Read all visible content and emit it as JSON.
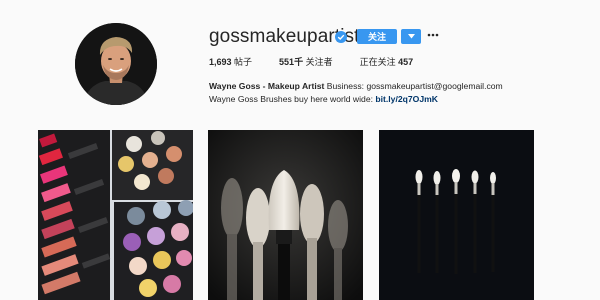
{
  "profile": {
    "username": "gossmakeupartist",
    "follow_label": "关注",
    "full_name": "Wayne Goss - Makeup Artist",
    "bio_text": " Business: gossmakeupartist@googlemail.com Wayne Goss Brushes buy here world wide: ",
    "bio_link": "bit.ly/2q7OJmK"
  },
  "stats": {
    "posts_count": "1,693",
    "posts_label": " 帖子",
    "followers_count": "551千",
    "followers_label": " 关注者",
    "following_label": "正在关注 ",
    "following_count": "457"
  },
  "icons": {
    "verified": "verified-badge-icon",
    "dropdown": "chevron-down-icon",
    "more": "more-options-icon"
  },
  "colors": {
    "accent": "#3897f0",
    "link": "#003569",
    "background": "#fafafa"
  },
  "posts": [
    {
      "name": "post-lipsticks-eyeshadow-palette"
    },
    {
      "name": "post-makeup-brushes-closeup"
    },
    {
      "name": "post-brushes-on-dark-background"
    }
  ]
}
